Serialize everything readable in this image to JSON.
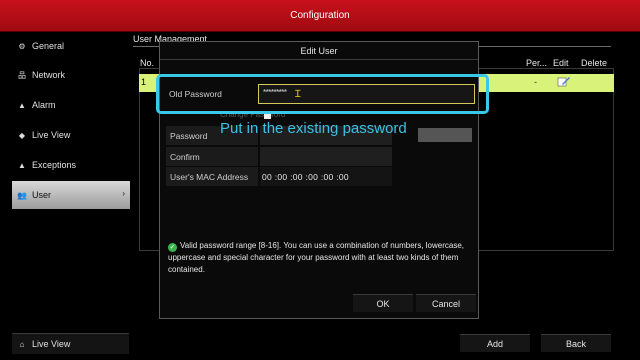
{
  "window": {
    "title": "Configuration"
  },
  "sidebar": {
    "items": [
      {
        "label": "General",
        "icon": "gear-icon",
        "glyph": "⚙"
      },
      {
        "label": "Network",
        "icon": "network-icon",
        "glyph": "品"
      },
      {
        "label": "Alarm",
        "icon": "alarm-icon",
        "glyph": "▲"
      },
      {
        "label": "Live View",
        "icon": "eye-icon",
        "glyph": "◆"
      },
      {
        "label": "Exceptions",
        "icon": "warning-icon",
        "glyph": "▲"
      },
      {
        "label": "User",
        "icon": "users-icon",
        "glyph": "👥",
        "active": true
      }
    ],
    "bottom": {
      "label": "Live View",
      "icon": "home-icon",
      "glyph": "⌂"
    }
  },
  "main": {
    "tab": "User Management",
    "columns": {
      "no": "No.",
      "permission": "Per...",
      "edit": "Edit",
      "delete": "Delete"
    },
    "rows": [
      {
        "no": "1",
        "permission": "-"
      }
    ],
    "buttons": {
      "add": "Add",
      "back": "Back"
    }
  },
  "dialog": {
    "title": "Edit User",
    "fields": {
      "old_password": {
        "label": "Old Password",
        "value": "*********"
      },
      "change_password": {
        "label": "Change Password"
      },
      "password": {
        "label": "Password"
      },
      "confirm": {
        "label": "Confirm"
      },
      "mac": {
        "label": "User's MAC Address",
        "value": "00  :00  :00  :00  :00  :00"
      }
    },
    "note": "Valid password range [8-16]. You can use a combination of numbers, lowercase, uppercase and special character for your password with at least two kinds of them contained.",
    "ok": "OK",
    "cancel": "Cancel"
  },
  "annotation": {
    "caption": "Put in the existing password",
    "color": "#39c8e8"
  },
  "colors": {
    "titlebar": "#c8111a",
    "selected_row": "#d9f27a",
    "accent": "#39c8e8"
  }
}
